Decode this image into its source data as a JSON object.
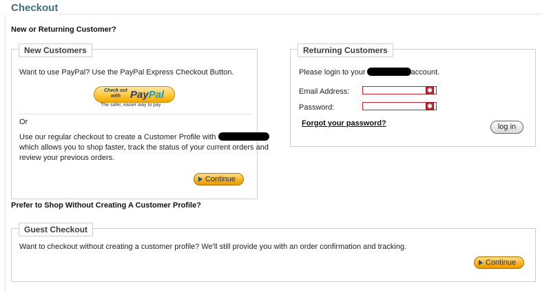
{
  "page": {
    "title": "Checkout",
    "subtitle": "New or Returning Customer?",
    "guest_prompt": "Prefer to Shop Without Creating A Customer Profile?"
  },
  "new_customers": {
    "legend": "New Customers",
    "paypal_intro": "Want to use PayPal? Use the PayPal Express Checkout Button.",
    "paypal_button": {
      "small_line1": "Check out",
      "small_line2": "with",
      "logo_pay": "Pay",
      "logo_pal": "Pal",
      "tagline": "The safer, easier way to pay"
    },
    "or_label": "Or",
    "regular_line1": "Use our regular checkout to create a Customer Profile with",
    "regular_line2": "which allows you to shop faster, track the status of your current orders and",
    "regular_line3": "review your previous orders.",
    "continue_label": "Continue"
  },
  "returning_customers": {
    "legend": "Returning Customers",
    "intro_before": "Please login to your",
    "intro_after": "account.",
    "email_label": "Email Address:",
    "password_label": "Password:",
    "email_value": "",
    "password_value": "",
    "required_icon": "required-asterisk-icon",
    "forgot_link": "Forgot your password?",
    "login_button": "log in"
  },
  "guest_checkout": {
    "legend": "Guest Checkout",
    "description": "Want to checkout without creating a customer profile? We'll still provide you with an order confirmation and tracking.",
    "continue_label": "Continue"
  },
  "colors": {
    "heading": "#3e6f7e",
    "required_border": "#c6202a",
    "button_orange": "#f7b01a",
    "paypal_blue_dark": "#253b80",
    "paypal_blue_light": "#179bd7"
  }
}
